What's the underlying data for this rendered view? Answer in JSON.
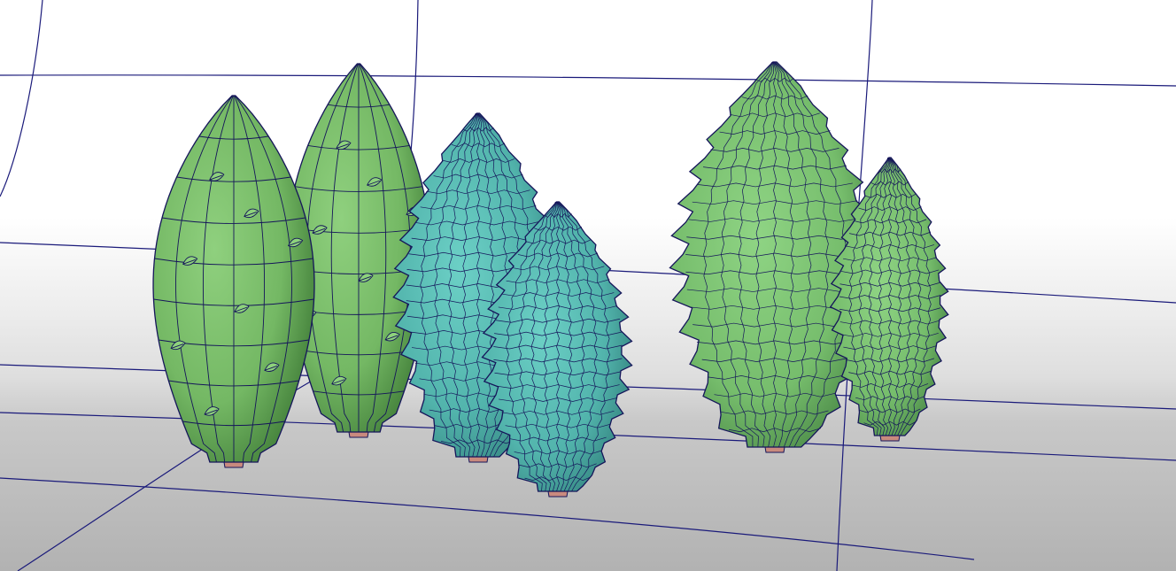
{
  "viewport": {
    "name": "3d-viewport",
    "shading": "wireframe-on-shaded",
    "colors": {
      "background_top": "#ffffff",
      "background_mid": "#ebebeb",
      "floor": "#b4b4b4",
      "grid_line": "#1a1a7a",
      "wire": "#15155a",
      "trunk": "#c98a7e"
    }
  },
  "models": [
    {
      "name": "smooth-tree-1",
      "style": "smooth-cone",
      "color": "#78b868",
      "has_leaf_decals": true
    },
    {
      "name": "smooth-tree-2",
      "style": "smooth-cone",
      "color": "#78b868",
      "has_leaf_decals": true
    },
    {
      "name": "spiky-pine-tree-1",
      "style": "spiky-pine",
      "color": "#55b8b0",
      "has_leaf_decals": false
    },
    {
      "name": "spiky-pine-tree-2",
      "style": "spiky-pine",
      "color": "#55b8b0",
      "has_leaf_decals": false
    },
    {
      "name": "bushy-tree-1",
      "style": "spiky-pine",
      "color": "#78c070",
      "has_leaf_decals": false
    },
    {
      "name": "bushy-tree-2",
      "style": "spiky-pine",
      "color": "#78c070",
      "has_leaf_decals": false
    }
  ]
}
